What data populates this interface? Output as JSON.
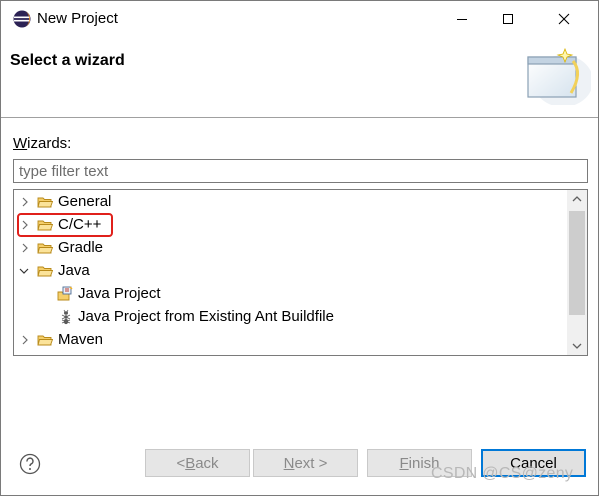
{
  "window": {
    "title": "New Project"
  },
  "banner": {
    "title": "Select a wizard"
  },
  "wizards": {
    "label_mnemonic": "W",
    "label_rest": "izards:",
    "filter_placeholder": "type filter text"
  },
  "tree": {
    "items": [
      {
        "label": "General",
        "expanded": false,
        "level": 0,
        "icon": "folder-icon"
      },
      {
        "label": "C/C++",
        "expanded": false,
        "level": 0,
        "icon": "folder-icon",
        "highlighted": true
      },
      {
        "label": "Gradle",
        "expanded": false,
        "level": 0,
        "icon": "folder-icon"
      },
      {
        "label": "Java",
        "expanded": true,
        "level": 0,
        "icon": "folder-icon"
      },
      {
        "label": "Java Project",
        "level": 1,
        "icon": "java-project-icon"
      },
      {
        "label": "Java Project from Existing Ant Buildfile",
        "level": 1,
        "icon": "ant-icon"
      },
      {
        "label": "Maven",
        "expanded": false,
        "level": 0,
        "icon": "folder-icon"
      }
    ]
  },
  "buttons": {
    "back_prefix": "< ",
    "back_mnemonic": "B",
    "back_rest": "ack",
    "next_mnemonic": "N",
    "next_rest": "ext >",
    "finish_mnemonic": "F",
    "finish_rest": "inish",
    "cancel": "Cancel"
  },
  "watermark": "CSDN @CS@zeny",
  "colors": {
    "highlight_border": "#e0201b",
    "default_button_border": "#0078d7",
    "folder": "#e8b84a"
  }
}
